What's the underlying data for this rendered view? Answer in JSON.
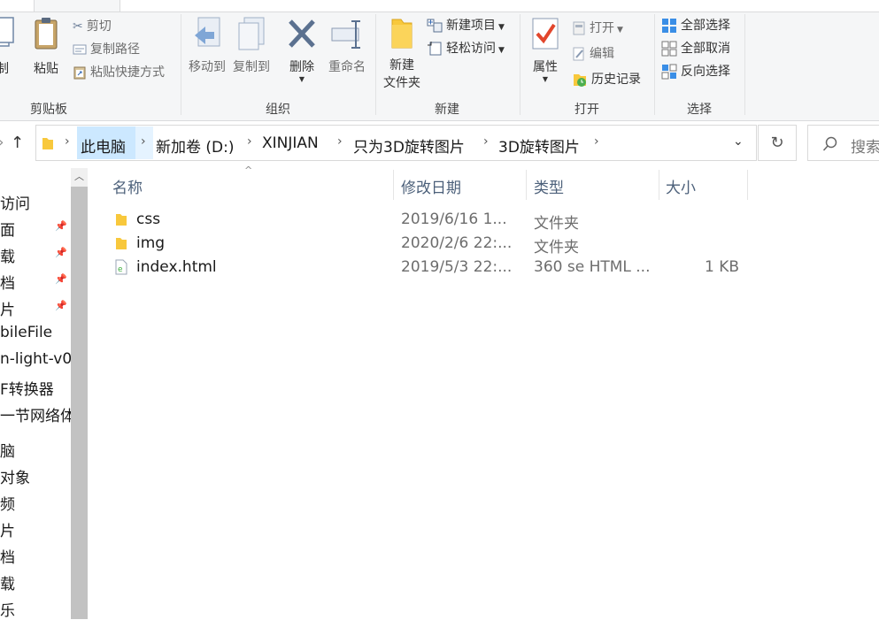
{
  "ribbon": {
    "clipboard": {
      "copy_label": "制",
      "paste_label": "粘贴",
      "cut_label": "剪切",
      "copy_path_label": "复制路径",
      "paste_shortcut_label": "粘贴快捷方式",
      "group_label": "剪贴板"
    },
    "organize": {
      "move_to_label": "移动到",
      "copy_to_label": "复制到",
      "delete_label": "删除",
      "rename_label": "重命名",
      "group_label": "组织"
    },
    "new": {
      "new_folder_label_line1": "新建",
      "new_folder_label_line2": "文件夹",
      "new_item_label": "新建项目",
      "easy_access_label": "轻松访问",
      "group_label": "新建"
    },
    "open": {
      "properties_label": "属性",
      "open_label": "打开",
      "edit_label": "编辑",
      "history_label": "历史记录",
      "group_label": "打开"
    },
    "select": {
      "select_all_label": "全部选择",
      "select_none_label": "全部取消",
      "invert_label": "反向选择",
      "group_label": "选择"
    }
  },
  "address": {
    "crumbs": [
      "此电脑",
      "新加卷 (D:)",
      "XINJIAN",
      "只为3D旋转图片",
      "3D旋转图片"
    ]
  },
  "search": {
    "placeholder": "搜索"
  },
  "nav": {
    "items": [
      "访问",
      "面",
      "载",
      "档",
      "片",
      "bileFile",
      "n-light-v0",
      "F转换器",
      "一节网络体",
      "脑",
      "对象",
      "频",
      "片",
      "档",
      "载",
      "乐"
    ]
  },
  "columns": {
    "name": "名称",
    "date": "修改日期",
    "type": "类型",
    "size": "大小"
  },
  "files": [
    {
      "name": "css",
      "date": "2019/6/16 1...",
      "type": "文件夹",
      "size": "",
      "icon": "folder-icon"
    },
    {
      "name": "img",
      "date": "2020/2/6 22:...",
      "type": "文件夹",
      "size": "",
      "icon": "folder-icon"
    },
    {
      "name": "index.html",
      "date": "2019/5/3 22:...",
      "type": "360 se HTML ...",
      "size": "1 KB",
      "icon": "html-file-icon"
    }
  ],
  "colors": {
    "folder": "#f8c83c",
    "header_text": "#4c607a",
    "selection": "#cce8ff"
  }
}
